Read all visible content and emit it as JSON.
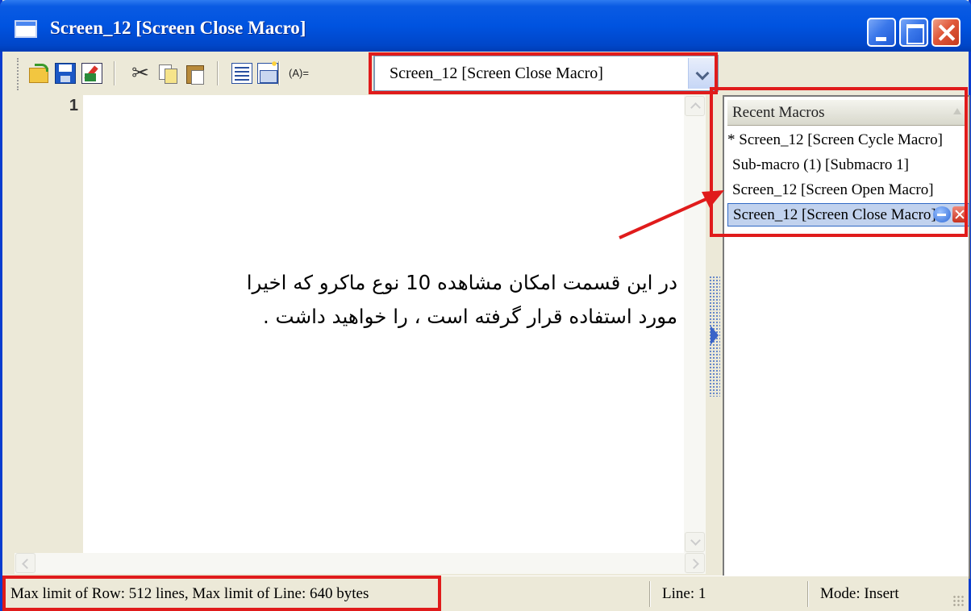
{
  "window": {
    "title": "Screen_12 [Screen Close Macro]"
  },
  "toolbar": {
    "icons": [
      "open-icon",
      "save-icon",
      "edit-icon",
      "cut-icon",
      "copy-icon",
      "paste-icon",
      "list-icon",
      "properties-icon",
      "variable-icon"
    ],
    "variable_label": "(A)=",
    "macro_select_value": "Screen_12 [Screen Close Macro]"
  },
  "editor": {
    "line_number": "1"
  },
  "recent_macros": {
    "header": "Recent Macros",
    "items": [
      {
        "label": "* Screen_12 [Screen Cycle Macro]"
      },
      {
        "label": "Sub-macro (1) [Submacro 1]"
      },
      {
        "label": "Screen_12 [Screen Open Macro]"
      },
      {
        "label": "Screen_12 [Screen Close Macro]"
      }
    ]
  },
  "annotation": {
    "text_line1": "در این قسمت امکان مشاهده 10 نوع ماکرو که اخیرا",
    "text_line2": "مورد استفاده قرار گرفته است ، را خواهید داشت .",
    "highlight_color": "#e01b1b"
  },
  "statusbar": {
    "limits": "Max limit of Row: 512 lines, Max limit of Line: 640 bytes",
    "line": "Line: 1",
    "mode": "Mode: Insert"
  },
  "colors": {
    "titlebar": "#0053e0",
    "annotation_red": "#e01b1b",
    "selected_item": "#c1d2ee"
  }
}
